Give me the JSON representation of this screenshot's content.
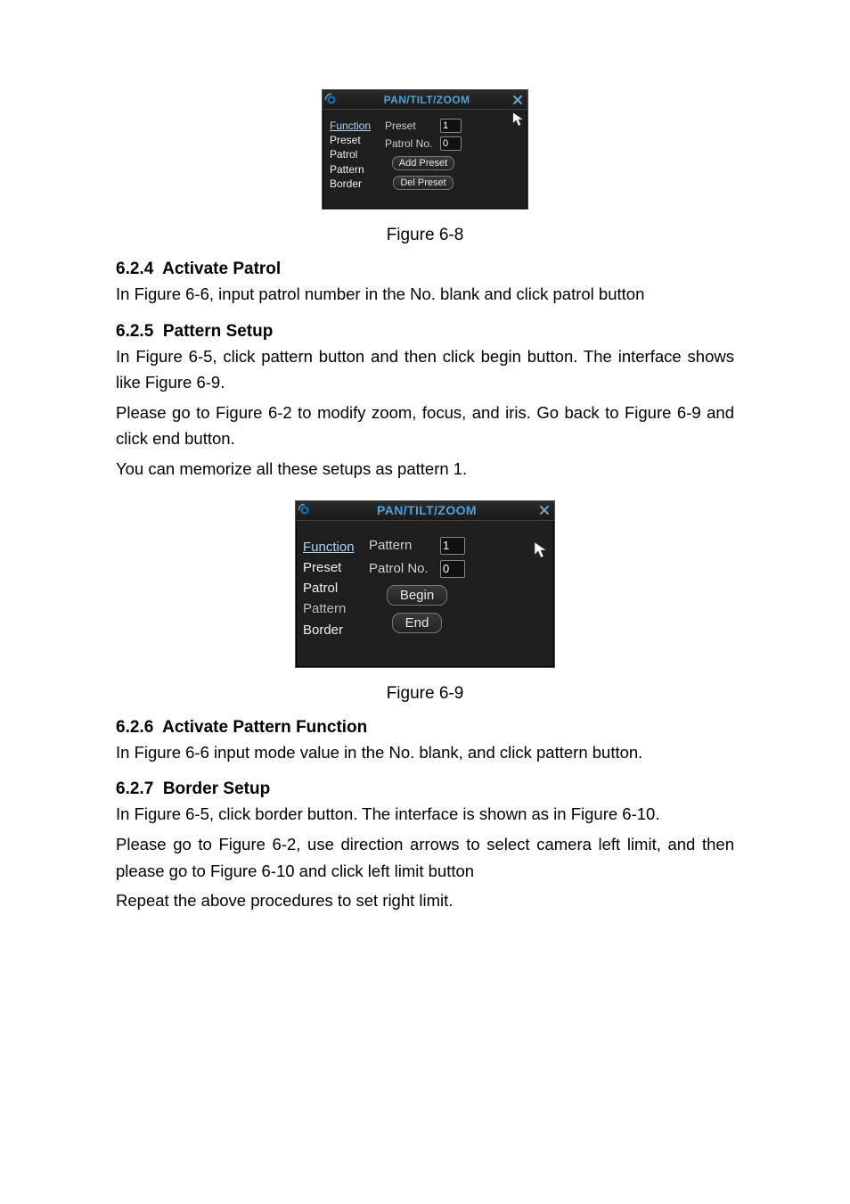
{
  "panel8": {
    "title": "PAN/TILT/ZOOM",
    "func_list": [
      "Function",
      "Preset",
      "Patrol",
      "Pattern",
      "Border"
    ],
    "selected_index": 0,
    "fields": {
      "label1": "Preset",
      "value1": "1",
      "label2": "Patrol No.",
      "value2": "0"
    },
    "buttons": [
      "Add Preset",
      "Del Preset"
    ],
    "caption": "Figure 6-8"
  },
  "sections": {
    "s624": {
      "num": "6.2.4",
      "title": "Activate Patrol",
      "p1": "In Figure 6-6, input patrol number in the No. blank and click patrol button"
    },
    "s625": {
      "num": "6.2.5",
      "title": "Pattern Setup",
      "p1": "In Figure 6-5, click pattern button and then click begin button. The interface shows like Figure 6-9.",
      "p2": "Please go to Figure 6-2 to modify zoom, focus, and iris.   Go back to Figure 6-9 and click end button.",
      "p3": "You can memorize all these setups as pattern 1."
    },
    "s626": {
      "num": "6.2.6",
      "title": "Activate Pattern Function",
      "p1": "In Figure 6-6 input mode value in the No. blank, and click pattern button."
    },
    "s627": {
      "num": "6.2.7",
      "title": "Border Setup",
      "p1": "In Figure 6-5, click border button. The interface is shown as in Figure 6-10.",
      "p2": "Please go to Figure 6-2, use direction arrows to select camera left limit, and then please go to Figure 6-10 and click left limit button",
      "p3": "Repeat the above procedures to set right limit."
    }
  },
  "panel9": {
    "title": "PAN/TILT/ZOOM",
    "func_list": [
      "Function",
      "Preset",
      "Patrol",
      "Pattern",
      "Border"
    ],
    "selected_index": 0,
    "fields": {
      "label1": "Pattern",
      "value1": "1",
      "label2": "Patrol No.",
      "value2": "0"
    },
    "buttons": [
      "Begin",
      "End"
    ],
    "caption": "Figure 6-9"
  }
}
